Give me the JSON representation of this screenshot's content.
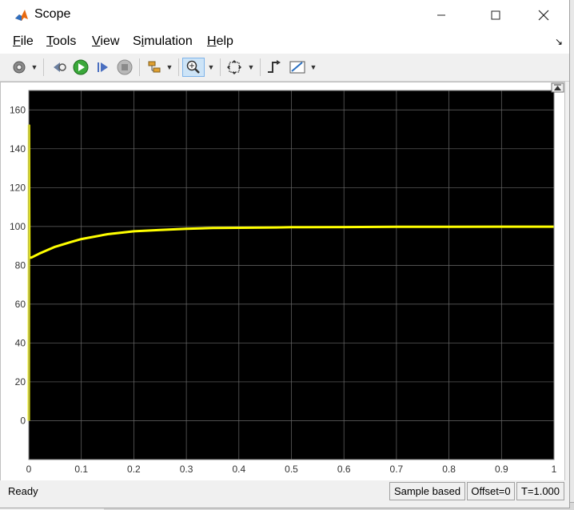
{
  "window": {
    "title": "Scope"
  },
  "menu": {
    "file": "ile",
    "file_mn": "F",
    "tools": "ools",
    "tools_mn": "T",
    "view": "iew",
    "view_mn": "V",
    "simulation_pre": "S",
    "simulation_mn": "i",
    "simulation_post": "mulation",
    "help": "elp",
    "help_mn": "H"
  },
  "toolbar": {
    "icons": [
      "gear-icon",
      "step-back-icon",
      "run-icon",
      "step-forward-icon",
      "stop-icon",
      "highlight-block-icon",
      "zoom-icon",
      "autoscale-icon",
      "triggers-icon",
      "measurements-icon"
    ]
  },
  "chart_data": {
    "type": "line",
    "xlim": [
      0,
      1
    ],
    "ylim": [
      -20,
      170
    ],
    "x_ticks": [
      "0",
      "0.1",
      "0.2",
      "0.3",
      "0.4",
      "0.5",
      "0.6",
      "0.7",
      "0.8",
      "0.9",
      "1"
    ],
    "y_ticks": [
      "0",
      "20",
      "40",
      "60",
      "80",
      "100",
      "120",
      "140",
      "160"
    ],
    "grid": true,
    "background": "#000000",
    "grid_color": "#6a6a6a",
    "series": [
      {
        "color": "#ffff00",
        "x": [
          0,
          0.0005,
          0.001,
          0.005,
          0.02,
          0.05,
          0.08,
          0.1,
          0.15,
          0.2,
          0.25,
          0.3,
          0.35,
          0.4,
          0.47,
          0.5,
          0.6,
          0.7,
          0.8,
          0.9,
          1.0
        ],
        "y": [
          0,
          152,
          84,
          84,
          86,
          89.5,
          92,
          93.5,
          96,
          97.5,
          98.2,
          98.8,
          99.2,
          99.3,
          99.5,
          99.6,
          99.7,
          99.8,
          99.8,
          99.9,
          99.9
        ]
      }
    ]
  },
  "status": {
    "left": "Ready",
    "sample": "Sample based",
    "offset": "Offset=0",
    "time": "T=1.000"
  }
}
